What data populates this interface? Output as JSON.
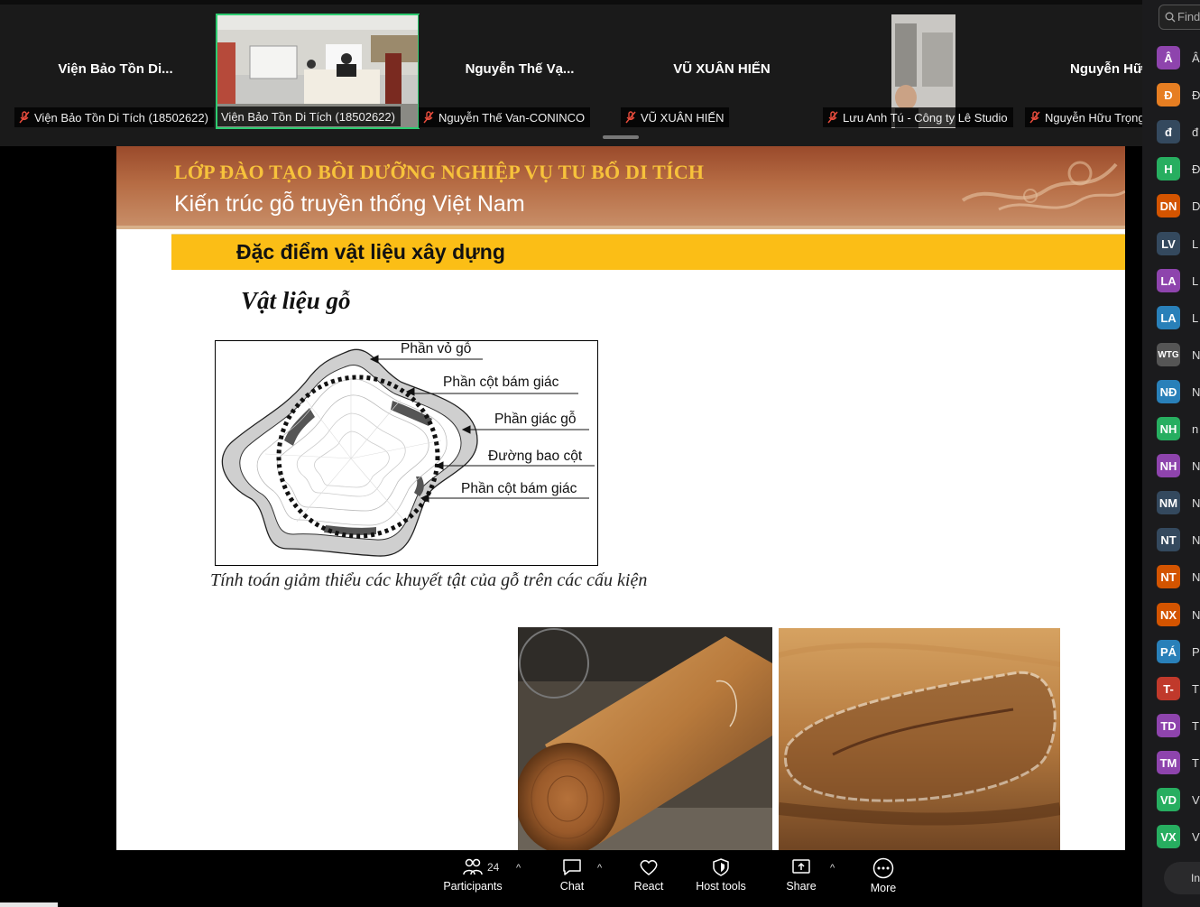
{
  "video_strip": {
    "tiles": [
      {
        "title": "Viện Bảo Tồn Di...",
        "tag": "Viện Bảo Tồn Di Tích (18502622)"
      },
      {
        "title": "",
        "tag": "Viện Bảo Tồn Di Tích (18502622)"
      },
      {
        "title": "Nguyễn Thế Vạ...",
        "tag": "Nguyễn Thế Van-CONINCO"
      },
      {
        "title": "VŨ XUÂN HIẾN",
        "tag": "VŨ XUÂN HIẾN"
      },
      {
        "title": "",
        "tag": "Lưu Anh Tú - Công ty Lê Studio"
      },
      {
        "title": "Nguyễn Hữ",
        "tag": "Nguyễn Hữu Trọng"
      }
    ]
  },
  "slide": {
    "course_title": "LỚP ĐÀO TẠO BỒI DƯỠNG NGHIỆP VỤ TU BỔ DI TÍCH",
    "course_subtitle": "Kiến trúc gỗ truyền thống Việt Nam",
    "section_title": "Đặc điểm vật liệu xây dựng",
    "material_heading": "Vật liệu gỗ",
    "diagram_labels": {
      "bark": "Phần vỏ gỗ",
      "column_angle_1": "Phần cột bám giác",
      "sapwood": "Phần giác gỗ",
      "column_outline": "Đường bao cột",
      "column_angle_2": "Phần cột bám giác"
    },
    "diagram_caption": "Tính toán giảm thiểu các khuyết tật của gỗ trên các cấu kiện"
  },
  "toolbar": {
    "participants_label": "Participants",
    "participants_count": "24",
    "chat_label": "Chat",
    "react_label": "React",
    "host_tools_label": "Host tools",
    "share_label": "Share",
    "more_label": "More"
  },
  "panel": {
    "search_placeholder": "Find",
    "participants": [
      {
        "initials": "Â",
        "name": "Â",
        "color": "#8e44ad"
      },
      {
        "initials": "Đ",
        "name": "Đ",
        "color": "#e67e22"
      },
      {
        "initials": "đ",
        "name": "đ",
        "color": "#34495e"
      },
      {
        "initials": "H",
        "name": "Đ",
        "color": "#27ae60"
      },
      {
        "initials": "DN",
        "name": "D",
        "color": "#d35400"
      },
      {
        "initials": "LV",
        "name": "L",
        "color": "#34495e"
      },
      {
        "initials": "LA",
        "name": "L",
        "color": "#8e44ad"
      },
      {
        "initials": "LA",
        "name": "L",
        "color": "#2980b9"
      },
      {
        "initials": "WTG",
        "name": "N",
        "color": "#555555"
      },
      {
        "initials": "NĐ",
        "name": "N",
        "color": "#2980b9"
      },
      {
        "initials": "NH",
        "name": "n",
        "color": "#27ae60"
      },
      {
        "initials": "NH",
        "name": "N",
        "color": "#8e44ad"
      },
      {
        "initials": "NM",
        "name": "N",
        "color": "#34495e"
      },
      {
        "initials": "NT",
        "name": "N",
        "color": "#34495e"
      },
      {
        "initials": "NT",
        "name": "N",
        "color": "#d35400"
      },
      {
        "initials": "NX",
        "name": "N",
        "color": "#d35400"
      },
      {
        "initials": "PÁ",
        "name": "P",
        "color": "#2980b9"
      },
      {
        "initials": "T-",
        "name": "T",
        "color": "#c0392b"
      },
      {
        "initials": "TD",
        "name": "T",
        "color": "#8e44ad"
      },
      {
        "initials": "TM",
        "name": "T",
        "color": "#8e44ad"
      },
      {
        "initials": "VD",
        "name": "V",
        "color": "#27ae60"
      },
      {
        "initials": "VX",
        "name": "V",
        "color": "#27ae60"
      }
    ],
    "bottom_button": "In"
  }
}
